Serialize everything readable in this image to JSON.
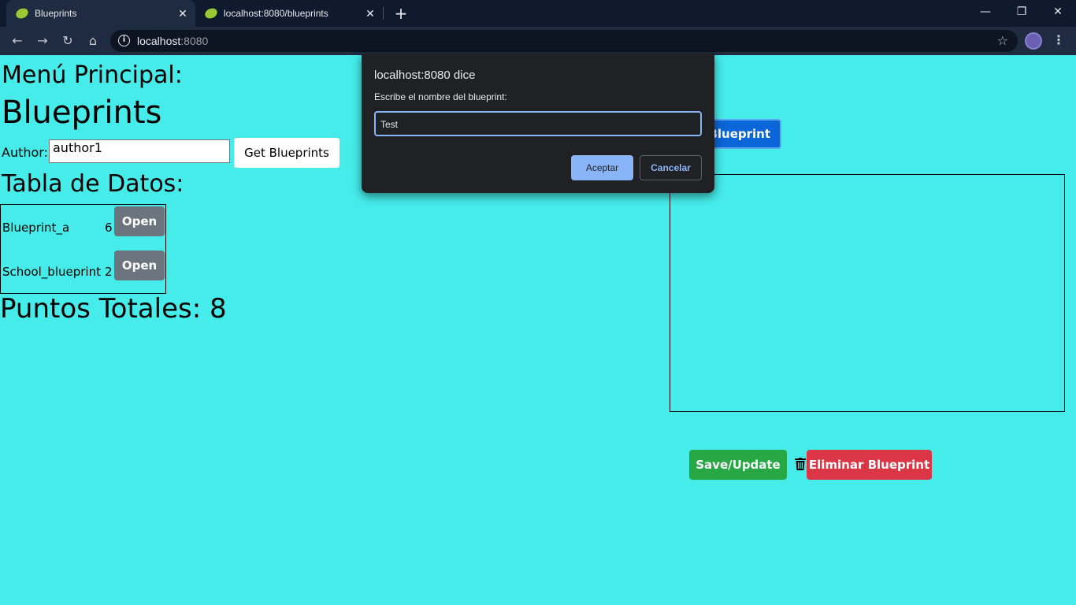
{
  "browser": {
    "tabs": [
      {
        "title": "Blueprints",
        "active": true
      },
      {
        "title": "localhost:8080/blueprints",
        "active": false
      }
    ],
    "close_glyph": "✕",
    "new_tab_glyph": "+",
    "url_host": "localhost",
    "url_port": ":8080",
    "window_controls": {
      "minimize": "—",
      "restore": "❐",
      "close": "✕"
    },
    "nav": {
      "back": "←",
      "forward": "→",
      "reload": "↻",
      "home": "⌂",
      "info": "i",
      "star": "☆",
      "menu": "⋮"
    }
  },
  "page": {
    "menu_heading": "Menú Principal:",
    "main_heading": "Blueprints",
    "author_label": "Author:",
    "author_value": "author1",
    "get_button": "Get Blueprints",
    "table_heading": "Tabla de Datos:",
    "rows": [
      {
        "name": "Blueprint_a",
        "points": "6",
        "action": "Open"
      },
      {
        "name": "School_blueprint",
        "points": "2",
        "action": "Open"
      }
    ],
    "total_label": "Puntos Totales: 8",
    "create_button_visible": "Blueprint",
    "save_button": "Save/Update",
    "delete_button": "Eliminar Blueprint"
  },
  "dialog": {
    "title": "localhost:8080 dice",
    "message": "Escribe el nombre del blueprint:",
    "input_value": "Test",
    "ok": "Aceptar",
    "cancel": "Cancelar"
  },
  "colors": {
    "page_bg": "#45ecea",
    "primary": "#0b66d8",
    "success": "#28a745",
    "danger": "#dc3545",
    "secondary": "#6c757d",
    "dialog_bg": "#202124",
    "dialog_accent": "#8ab4f8"
  }
}
